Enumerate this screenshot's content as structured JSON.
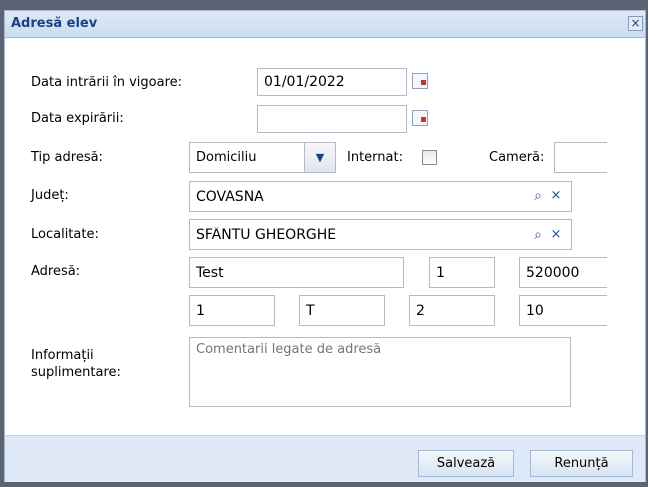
{
  "dialog": {
    "title": "Adresă elev",
    "close_symbol": "×",
    "close_icon": "close-icon"
  },
  "form": {
    "start_date_label": "Data intrării în vigoare:",
    "start_date_value": "01/01/2022",
    "expiry_date_label": "Data expirării:",
    "expiry_date_value": "",
    "address_type_label": "Tip adresă:",
    "address_type_value": "Domiciliu",
    "internat_label": "Internat:",
    "internat_checked": false,
    "room_label": "Cameră:",
    "room_value": "",
    "county_label": "Județ:",
    "county_value": "COVASNA",
    "locality_label": "Localitate:",
    "locality_value": "SFÂNTU GHEORGHE",
    "address_label": "Adresă:",
    "address_fields_row1": [
      "Test",
      "1",
      "520000"
    ],
    "address_fields_row2": [
      "1",
      "T",
      "2",
      "10"
    ],
    "info_label_line1": "Informații",
    "info_label_line2": "suplimentare:",
    "info_placeholder": "Comentarii legate de adresă"
  },
  "footer": {
    "save_label": "Salvează",
    "cancel_label": "Renunță"
  },
  "icons": {
    "calendar": "calendar-icon",
    "dropdown": "chevron-down-icon",
    "search": "search-icon",
    "clear": "clear-icon"
  },
  "colors": {
    "title_text": "#15428b",
    "border": "#99bbe8",
    "footer_bg": "#dfe8f6"
  }
}
